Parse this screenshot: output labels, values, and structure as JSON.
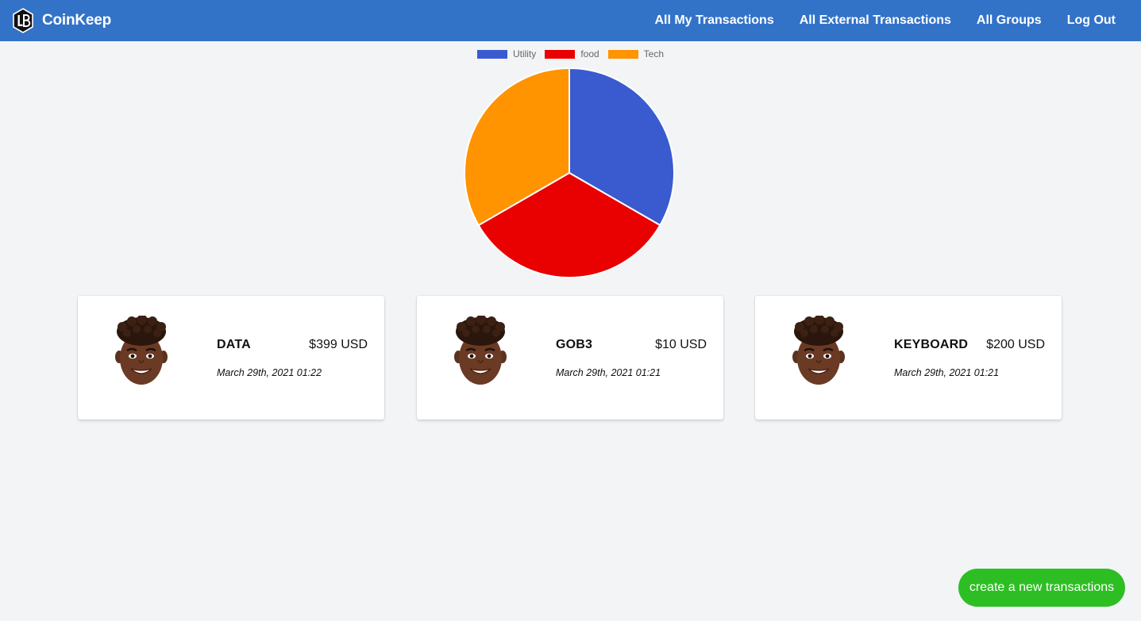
{
  "app": {
    "name": "CoinKeep"
  },
  "nav": {
    "links": [
      {
        "label": "All My Transactions"
      },
      {
        "label": "All External Transactions"
      },
      {
        "label": "All Groups"
      },
      {
        "label": "Log Out"
      }
    ]
  },
  "chart_data": {
    "type": "pie",
    "categories": [
      "Utility",
      "food",
      "Tech"
    ],
    "values": [
      1,
      1,
      1
    ],
    "colors": [
      "#3a5bcf",
      "#e90000",
      "#ff9300"
    ],
    "legend_position": "top"
  },
  "transactions": [
    {
      "title": "DATA",
      "amount": "$399 USD",
      "date": "March 29th, 2021 01:22"
    },
    {
      "title": "GOB3",
      "amount": "$10 USD",
      "date": "March 29th, 2021 01:21"
    },
    {
      "title": "KEYBOARD",
      "amount": "$200 USD",
      "date": "March 29th, 2021 01:21"
    }
  ],
  "actions": {
    "create_label": "create a new transactions"
  },
  "colors": {
    "navbar": "#3273c8",
    "fab": "#2dbe23",
    "background": "#f2f4f6"
  }
}
